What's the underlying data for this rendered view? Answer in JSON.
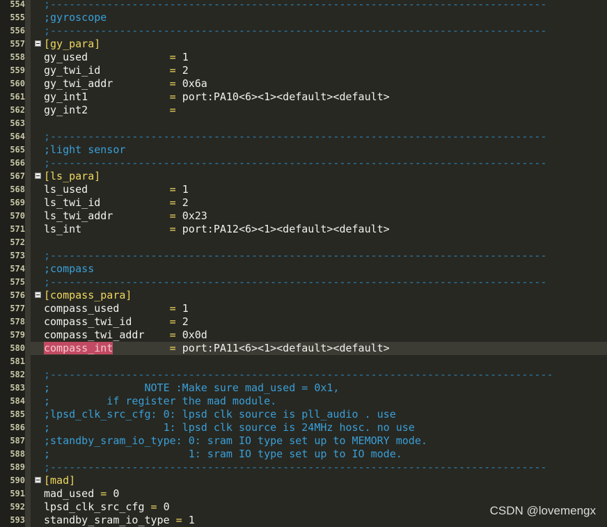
{
  "editor": {
    "dash_short": ";-------------------------------------------------------------------------------",
    "dash_long": ";--------------------------------------------------------------------------------",
    "lines": [
      {
        "n": "554",
        "type": "dash"
      },
      {
        "n": "555",
        "type": "comment",
        "text": ";gyroscope"
      },
      {
        "n": "556",
        "type": "dash"
      },
      {
        "n": "557",
        "type": "section",
        "text": "[gy_para]"
      },
      {
        "n": "558",
        "type": "kv",
        "key": "gy_used",
        "eq": "=",
        "val": "1",
        "pad": 20
      },
      {
        "n": "559",
        "type": "kv",
        "key": "gy_twi_id",
        "eq": "=",
        "val": "2",
        "pad": 20
      },
      {
        "n": "560",
        "type": "kv",
        "key": "gy_twi_addr",
        "eq": "=",
        "val": "0x6a",
        "pad": 20
      },
      {
        "n": "561",
        "type": "kv",
        "key": "gy_int1",
        "eq": "=",
        "val": "port:PA10<6><1><default><default>",
        "pad": 20
      },
      {
        "n": "562",
        "type": "kv",
        "key": "gy_int2",
        "eq": "=",
        "val": "",
        "pad": 20
      },
      {
        "n": "563",
        "type": "blank"
      },
      {
        "n": "564",
        "type": "dash"
      },
      {
        "n": "565",
        "type": "comment",
        "text": ";light sensor"
      },
      {
        "n": "566",
        "type": "dash"
      },
      {
        "n": "567",
        "type": "section",
        "text": "[ls_para]"
      },
      {
        "n": "568",
        "type": "kv",
        "key": "ls_used",
        "eq": "=",
        "val": "1",
        "pad": 20
      },
      {
        "n": "569",
        "type": "kv",
        "key": "ls_twi_id",
        "eq": "=",
        "val": "2",
        "pad": 20
      },
      {
        "n": "570",
        "type": "kv",
        "key": "ls_twi_addr",
        "eq": "=",
        "val": "0x23",
        "pad": 20
      },
      {
        "n": "571",
        "type": "kv",
        "key": "ls_int",
        "eq": "=",
        "val": "port:PA12<6><1><default><default>",
        "pad": 20
      },
      {
        "n": "572",
        "type": "blank"
      },
      {
        "n": "573",
        "type": "dash"
      },
      {
        "n": "574",
        "type": "comment",
        "text": ";compass"
      },
      {
        "n": "575",
        "type": "dash"
      },
      {
        "n": "576",
        "type": "section",
        "text": "[compass_para]"
      },
      {
        "n": "577",
        "type": "kv",
        "key": "compass_used",
        "eq": "=",
        "val": "1",
        "pad": 20
      },
      {
        "n": "578",
        "type": "kv",
        "key": "compass_twi_id",
        "eq": "=",
        "val": "2",
        "pad": 20
      },
      {
        "n": "579",
        "type": "kv",
        "key": "compass_twi_addr",
        "eq": "=",
        "val": "0x0d",
        "pad": 20
      },
      {
        "n": "580",
        "type": "kv",
        "key": "compass_int",
        "eq": "=",
        "val": "port:PA11<6><1><default><default>",
        "pad": 20,
        "highlight": true
      },
      {
        "n": "581",
        "type": "blank"
      },
      {
        "n": "582",
        "type": "dashlong"
      },
      {
        "n": "583",
        "type": "comment",
        "text": ";               NOTE :Make sure mad_used = 0x1,"
      },
      {
        "n": "584",
        "type": "comment",
        "text": ";         if register the mad module."
      },
      {
        "n": "585",
        "type": "comment",
        "text": ";lpsd_clk_src_cfg: 0: lpsd clk source is pll_audio . use"
      },
      {
        "n": "586",
        "type": "comment",
        "text": ";                  1: lpsd clk source is 24MHz hosc. no use"
      },
      {
        "n": "587",
        "type": "comment",
        "text": ";standby_sram_io_type: 0: sram IO type set up to MEMORY mode."
      },
      {
        "n": "588",
        "type": "comment",
        "text": ";                      1: sram IO type set up to IO mode."
      },
      {
        "n": "589",
        "type": "dash"
      },
      {
        "n": "590",
        "type": "section",
        "text": "[mad]"
      },
      {
        "n": "591",
        "type": "kv",
        "key": "mad_used",
        "eq": "=",
        "val": "0",
        "pad": 9
      },
      {
        "n": "592",
        "type": "kv",
        "key": "lpsd_clk_src_cfg",
        "eq": "=",
        "val": "0",
        "pad": 17
      },
      {
        "n": "593",
        "type": "kv",
        "key": "standby_sram_io_type",
        "eq": "=",
        "val": "1",
        "pad": 21
      }
    ]
  },
  "watermark": "CSDN @lovemengx"
}
